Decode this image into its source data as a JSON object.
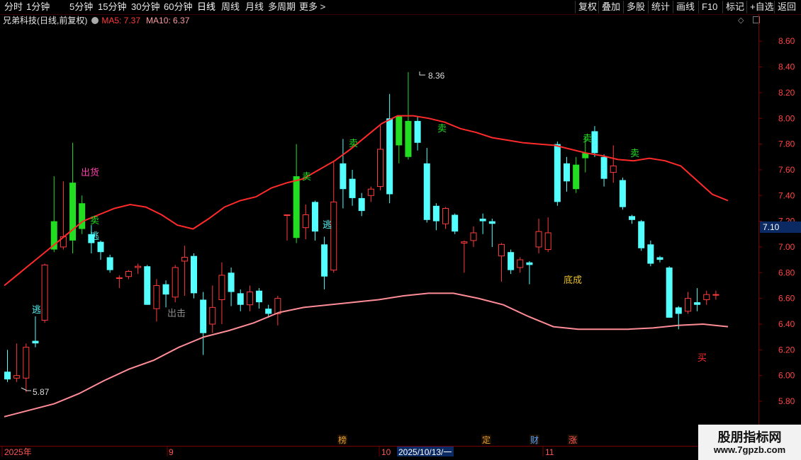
{
  "toolbar": {
    "periods": [
      "分时",
      "1分钟",
      "5分钟",
      "15分钟",
      "30分钟",
      "60分钟",
      "日线",
      "周线",
      "月线",
      "多周期",
      "更多 >"
    ],
    "active_period": "日线",
    "actions": [
      "复权",
      "叠加",
      "多股",
      "统计",
      "画线",
      "F10",
      "标记",
      "+自选",
      "返回"
    ]
  },
  "header": {
    "title": "兄弟科技(日线,前复权)",
    "ma5": "MA5: 7.37",
    "ma10": "MA10: 6.37"
  },
  "price_axis": [
    "8.60",
    "8.40",
    "8.20",
    "8.00",
    "7.80",
    "7.60",
    "7.40",
    "7.20",
    "7.00",
    "6.80",
    "6.60",
    "6.40",
    "6.20",
    "6.00",
    "5.80"
  ],
  "current_price_tag": "7.10",
  "annotations": {
    "high": "8.36",
    "low": "5.87",
    "chuhuo": "出货",
    "chuji": "出击",
    "dicheng": "底成",
    "buy": "买",
    "sell": "卖",
    "escape": "逃"
  },
  "date_axis": {
    "year": "2025年",
    "m9": "9",
    "m10": "10",
    "m11": "11",
    "cursor_date": "2025/10/13/一"
  },
  "event_tags": [
    "榜",
    "定",
    "财",
    "涨"
  ],
  "watermark": {
    "line1": "股朋指标网",
    "line2": "www.7gpzb.com"
  },
  "colors": {
    "up": "#ff3b3b",
    "down": "#54ffff",
    "signal": "#22dd22",
    "ma_red": "#ff2a2a",
    "ma_pink": "#ff8c96"
  },
  "chart_data": {
    "type": "candlestick",
    "ylim": [
      5.7,
      8.7
    ],
    "candles": [
      [
        6.03,
        5.97,
        6.2,
        5.95
      ],
      [
        5.98,
        6.0,
        6.25,
        5.95
      ],
      [
        5.98,
        6.22,
        6.25,
        5.87
      ],
      [
        6.27,
        6.25,
        6.46,
        6.22
      ],
      [
        6.43,
        6.86,
        6.87,
        6.41
      ],
      [
        6.98,
        7.2,
        7.55,
        6.96
      ],
      [
        7.0,
        7.08,
        7.51,
        6.98
      ],
      [
        7.05,
        7.5,
        7.81,
        6.95
      ],
      [
        7.14,
        7.34,
        7.4,
        7.1
      ],
      [
        7.1,
        7.03,
        7.17,
        6.95
      ],
      [
        7.04,
        6.96,
        7.05,
        6.9
      ],
      [
        6.92,
        6.82,
        6.94,
        6.8
      ],
      [
        6.76,
        6.76,
        6.78,
        6.68
      ],
      [
        6.77,
        6.81,
        6.82,
        6.75
      ],
      [
        6.84,
        6.85,
        6.87,
        6.79
      ],
      [
        6.85,
        6.55,
        6.86,
        6.55
      ],
      [
        6.52,
        6.7,
        6.75,
        6.42
      ],
      [
        6.71,
        6.63,
        6.74,
        6.53
      ],
      [
        6.61,
        6.84,
        6.86,
        6.57
      ],
      [
        6.89,
        6.92,
        7.01,
        6.62
      ],
      [
        6.93,
        6.64,
        6.95,
        6.6
      ],
      [
        6.59,
        6.33,
        6.65,
        6.16
      ],
      [
        6.4,
        6.53,
        6.7,
        6.33
      ],
      [
        6.59,
        6.78,
        6.88,
        6.4
      ],
      [
        6.8,
        6.65,
        6.84,
        6.54
      ],
      [
        6.64,
        6.55,
        6.67,
        6.5
      ],
      [
        6.55,
        6.65,
        6.7,
        6.5
      ],
      [
        6.66,
        6.57,
        6.68,
        6.52
      ],
      [
        6.52,
        6.48,
        6.55,
        6.45
      ],
      [
        6.48,
        6.6,
        6.62,
        6.39
      ],
      [
        7.25,
        7.25,
        7.25,
        7.05
      ],
      [
        7.55,
        7.07,
        7.8,
        7.03
      ],
      [
        7.15,
        7.25,
        7.33,
        7.06
      ],
      [
        7.35,
        7.12,
        7.36,
        7.05
      ],
      [
        7.02,
        6.77,
        7.08,
        6.67
      ],
      [
        6.82,
        7.35,
        7.66,
        6.8
      ],
      [
        7.65,
        7.45,
        7.84,
        7.3
      ],
      [
        7.53,
        7.38,
        7.6,
        7.32
      ],
      [
        7.38,
        7.28,
        7.42,
        7.24
      ],
      [
        7.4,
        7.45,
        7.47,
        7.35
      ],
      [
        7.47,
        7.76,
        7.95,
        7.44
      ],
      [
        8.0,
        7.41,
        8.19,
        7.34
      ],
      [
        8.02,
        7.79,
        8.02,
        7.65
      ],
      [
        7.7,
        7.98,
        8.36,
        7.68
      ],
      [
        7.98,
        7.81,
        8.01,
        7.75
      ],
      [
        7.65,
        7.21,
        7.77,
        7.19
      ],
      [
        7.32,
        7.2,
        7.34,
        7.13
      ],
      [
        7.18,
        7.3,
        7.31,
        7.14
      ],
      [
        7.25,
        7.12,
        7.26,
        7.1
      ],
      [
        7.03,
        7.04,
        7.05,
        6.8
      ],
      [
        7.05,
        7.11,
        7.16,
        7.0
      ],
      [
        7.22,
        7.2,
        7.26,
        7.1
      ],
      [
        7.2,
        7.18,
        7.22,
        7.0
      ],
      [
        6.93,
        7.02,
        7.03,
        6.73
      ],
      [
        6.96,
        6.82,
        6.98,
        6.79
      ],
      [
        6.84,
        6.9,
        6.92,
        6.8
      ],
      [
        6.88,
        6.86,
        6.89,
        6.71
      ],
      [
        7.0,
        7.12,
        7.22,
        6.95
      ],
      [
        6.98,
        7.11,
        7.23,
        6.96
      ],
      [
        7.8,
        7.35,
        7.82,
        7.32
      ],
      [
        7.65,
        7.51,
        7.7,
        7.43
      ],
      [
        7.45,
        7.64,
        7.7,
        7.42
      ],
      [
        7.73,
        7.69,
        7.86,
        7.58
      ],
      [
        7.9,
        7.73,
        7.94,
        7.7
      ],
      [
        7.7,
        7.53,
        7.72,
        7.47
      ],
      [
        7.58,
        7.63,
        7.79,
        7.5
      ],
      [
        7.52,
        7.31,
        7.54,
        7.29
      ],
      [
        7.24,
        7.21,
        7.25,
        7.18
      ],
      [
        7.2,
        6.99,
        7.21,
        6.97
      ],
      [
        7.02,
        6.87,
        7.05,
        6.85
      ],
      [
        6.92,
        6.9,
        6.93,
        6.88
      ],
      [
        6.84,
        6.45,
        6.85,
        6.45
      ],
      [
        6.53,
        6.48,
        6.54,
        6.36
      ],
      [
        6.5,
        6.6,
        6.65,
        6.48
      ],
      [
        6.57,
        6.55,
        6.68,
        6.5
      ],
      [
        6.59,
        6.63,
        6.66,
        6.55
      ],
      [
        6.63,
        6.63,
        6.66,
        6.59
      ]
    ],
    "ma5": [
      6.7,
      6.8,
      6.9,
      7.0,
      7.1,
      7.2,
      7.25,
      7.3,
      7.33,
      7.31,
      7.25,
      7.17,
      7.14,
      7.22,
      7.31,
      7.36,
      7.39,
      7.46,
      7.5,
      7.53,
      7.6,
      7.67,
      7.76,
      7.86,
      7.96,
      8.02,
      8.02,
      8.0,
      7.97,
      7.92,
      7.89,
      7.85,
      7.83,
      7.81,
      7.8,
      7.79,
      7.76,
      7.73,
      7.71,
      7.68,
      7.67,
      7.69,
      7.67,
      7.63,
      7.52,
      7.41,
      7.36
    ],
    "ma10": [
      5.68,
      5.73,
      5.78,
      5.86,
      5.96,
      6.05,
      6.12,
      6.22,
      6.3,
      6.35,
      6.41,
      6.49,
      6.53,
      6.55,
      6.57,
      6.59,
      6.62,
      6.64,
      6.64,
      6.6,
      6.55,
      6.46,
      6.38,
      6.36,
      6.36,
      6.36,
      6.37,
      6.39,
      6.4,
      6.38
    ]
  }
}
